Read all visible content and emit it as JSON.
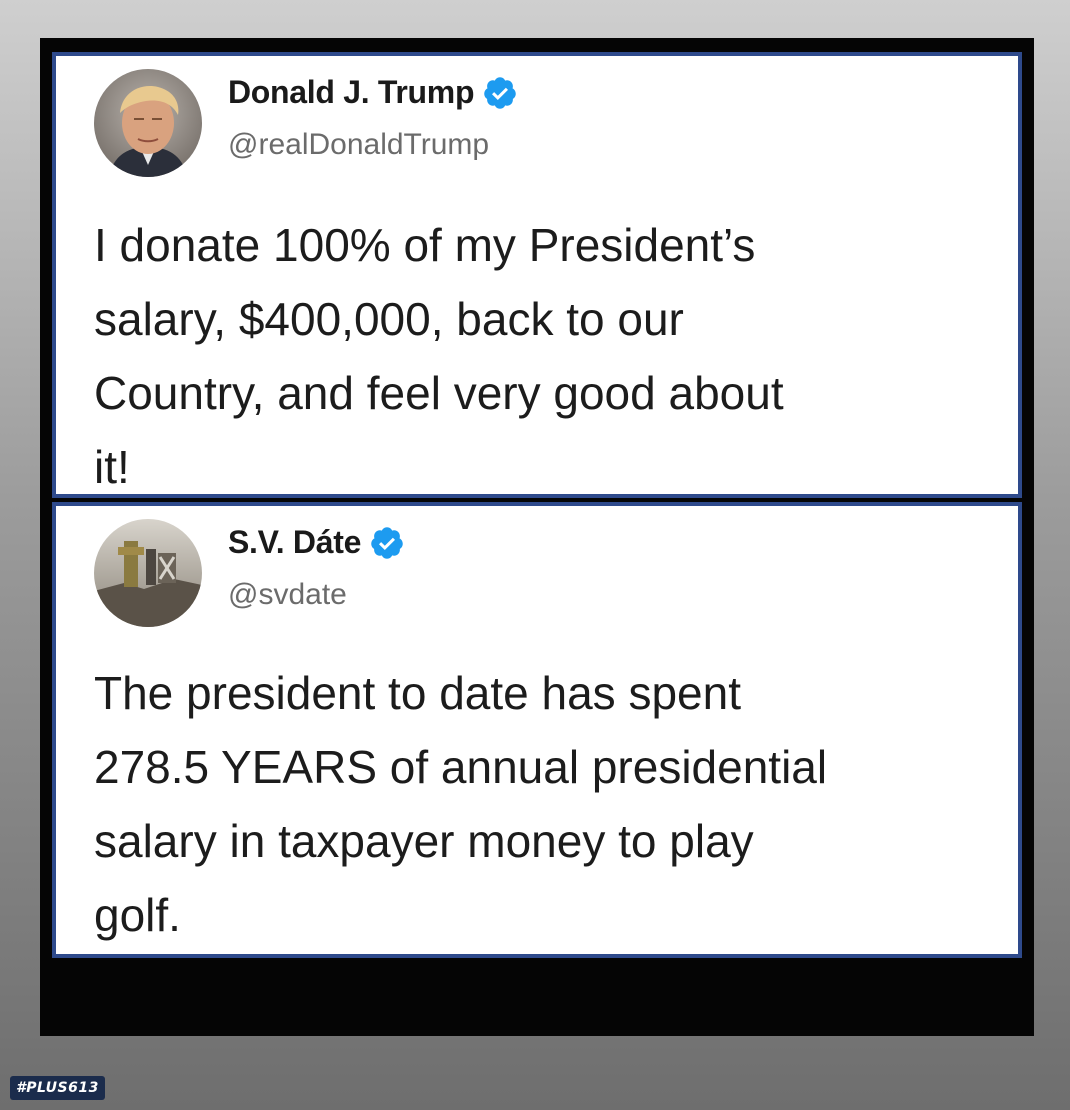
{
  "tweets": [
    {
      "display_name": "Donald J. Trump",
      "handle": "@realDonaldTrump",
      "verified": true,
      "verified_icon": "verified-badge-icon",
      "text": "I donate 100% of my President’s\nsalary, $400,000, back to our\nCountry, and feel very good about\nit!"
    },
    {
      "display_name": "S.V. Dáte",
      "handle": "@svdate",
      "verified": true,
      "verified_icon": "verified-badge-icon",
      "text": "The president to date has spent\n278.5 YEARS of annual presidential\nsalary in taxpayer money to play\ngolf."
    }
  ],
  "watermark": {
    "text": "#PLUS613"
  },
  "colors": {
    "verified": "#1d9bf0",
    "card_border": "#2e4a8c",
    "frame": "#050505",
    "handle": "#6b6b6b"
  }
}
